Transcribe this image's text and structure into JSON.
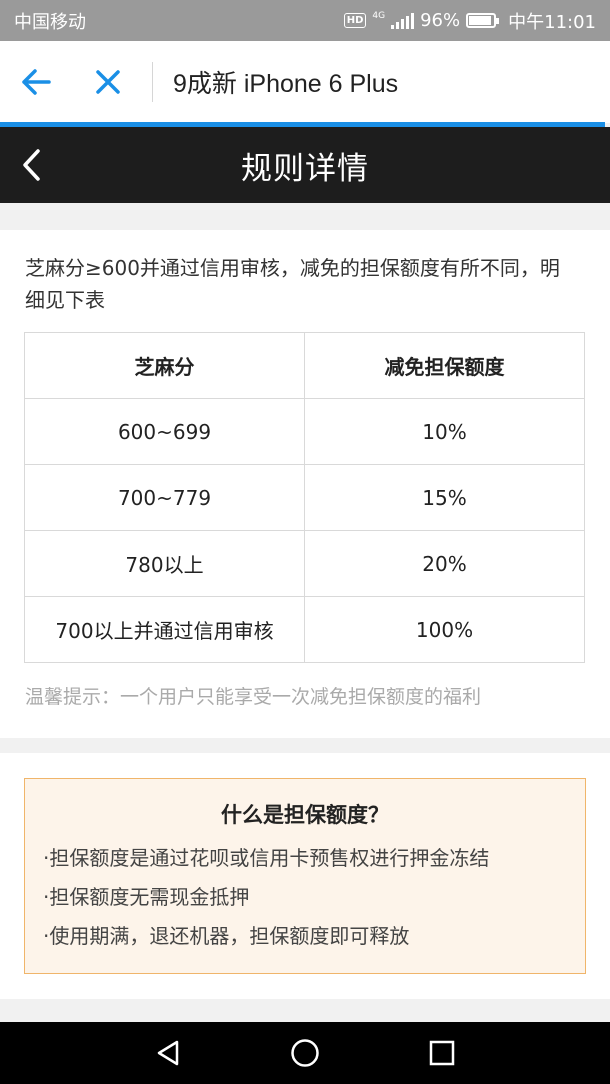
{
  "status_bar": {
    "carrier": "中国移动",
    "hd": "HD",
    "network": "4G",
    "battery": "96%",
    "time": "中午11:01"
  },
  "browser": {
    "page_title": "9成新 iPhone 6 Plus",
    "progress_color": "#1a8fe6"
  },
  "nav": {
    "title": "规则详情"
  },
  "rules": {
    "intro": "芝麻分≥600并通过信用审核，减免的担保额度有所不同，明细见下表",
    "table": {
      "headers": [
        "芝麻分",
        "减免担保额度"
      ],
      "rows": [
        [
          "600~699",
          "10%"
        ],
        [
          "700~779",
          "15%"
        ],
        [
          "780以上",
          "20%"
        ],
        [
          "700以上并通过信用审核",
          "100%"
        ]
      ]
    },
    "tip": "温馨提示：一个用户只能享受一次减免担保额度的福利"
  },
  "info": {
    "title": "什么是担保额度？",
    "items": [
      "·担保额度是通过花呗或信用卡预售权进行押金冻结",
      "·担保额度无需现金抵押",
      "·使用期满，退还机器，担保额度即可释放"
    ],
    "border_color": "#f0b56a",
    "bg_color": "#fdf4ea"
  },
  "system_nav": {
    "icons": [
      "back-triangle-icon",
      "home-circle-icon",
      "recents-square-icon"
    ]
  }
}
